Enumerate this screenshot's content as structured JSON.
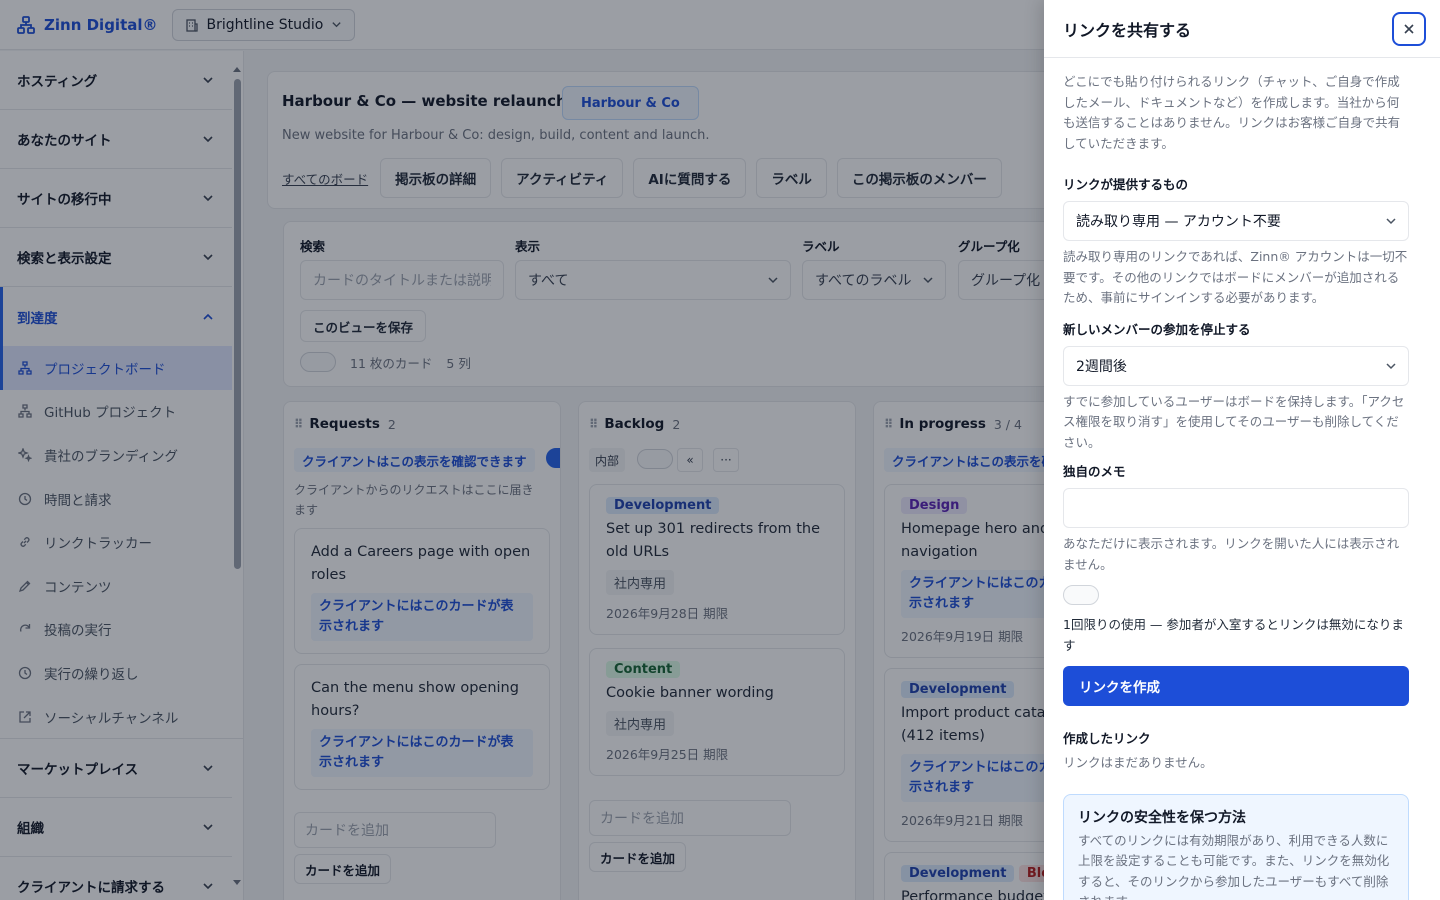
{
  "topbar": {
    "brand": "Zinn Digital®",
    "workspace": "Brightline Studio"
  },
  "sidebar": {
    "sections_top": [
      "ホスティング",
      "あなたのサイト",
      "サイトの移行中",
      "検索と表示設定"
    ],
    "active_section": "到達度",
    "items": [
      {
        "label": "プロジェクトボード",
        "icon": "board-icon",
        "active": true
      },
      {
        "label": "GitHub プロジェクト",
        "icon": "board-icon"
      },
      {
        "label": "貴社のブランディング",
        "icon": "sparkle-icon"
      },
      {
        "label": "時間と請求",
        "icon": "clock-icon"
      },
      {
        "label": "リンクトラッカー",
        "icon": "link-icon"
      },
      {
        "label": "コンテンツ",
        "icon": "pencil-icon"
      },
      {
        "label": "投稿の実行",
        "icon": "refresh-icon"
      },
      {
        "label": "実行の繰り返し",
        "icon": "clock-icon"
      },
      {
        "label": "ソーシャルチャンネル",
        "icon": "external-link-icon"
      }
    ],
    "sections_bottom": [
      "マーケットプレイス",
      "組織",
      "クライアントに請求する"
    ]
  },
  "project": {
    "title": "Harbour & Co — website relaunch",
    "client_badge": "Harbour & Co",
    "description": "New website for Harbour & Co: design, build, content and launch.",
    "all_boards_link": "すべてのボード",
    "tabs": [
      "掲示板の詳細",
      "アクティビティ",
      "AIに質問する",
      "ラベル",
      "この掲示板のメンバー"
    ]
  },
  "filters": {
    "search_label": "検索",
    "search_placeholder": "カードのタイトルまたは説明",
    "view_label": "表示",
    "view_value": "すべて",
    "label_label": "ラベル",
    "label_value": "すべてのラベル",
    "group_label": "グループ化",
    "group_value": "グループ化",
    "save_view": "このビューを保存",
    "card_count": "11 枚のカード",
    "column_count": "5 列"
  },
  "columns": [
    {
      "name": "Requests",
      "count": "2",
      "visibility": "クライアントはこの表示を確認できます",
      "description": "クライアントからのリクエストはここに届きます",
      "cards": [
        {
          "title": "Add a Careers page with open roles",
          "visible": "クライアントにはこのカードが表示されます"
        },
        {
          "title": "Can the menu show opening hours?",
          "visible": "クライアントにはこのカードが表示されます"
        }
      ],
      "add_placeholder": "カードを追加",
      "add_button": "カードを追加"
    },
    {
      "name": "Backlog",
      "count": "2",
      "internal": "内部",
      "collapse": "«",
      "more": "···",
      "cards": [
        {
          "tag": "Development",
          "title": "Set up 301 redirects from the old URLs",
          "internal": "社内専用",
          "due": "2026年9月28日 期限"
        },
        {
          "tag": "Content",
          "title": "Cookie banner wording",
          "internal": "社内専用",
          "due": "2026年9月25日 期限"
        }
      ],
      "add_placeholder": "カードを追加",
      "add_button": "カードを追加"
    },
    {
      "name": "In progress",
      "count": "3 / 4",
      "visibility": "クライアントはこの表示を確認できます",
      "cards": [
        {
          "tag": "Design",
          "title": "Homepage hero and navigation",
          "visible": "クライアントにはこのカードが表示されます",
          "due": "2026年9月19日 期限"
        },
        {
          "tag": "Development",
          "title": "Import product catalogue (412 items)",
          "visible": "クライアントにはこのカードが表示されます",
          "due": "2026年9月21日 期限"
        },
        {
          "tag": "Development",
          "tag2": "Blocked",
          "title": "Performance budget"
        }
      ]
    }
  ],
  "share_panel": {
    "title": "リンクを共有する",
    "intro": "どこにでも貼り付けられるリンク（チャット、ご自身で作成したメール、ドキュメントなど）を作成します。当社から何も送信することはありません。リンクはお客様ご自身で共有していただきます。",
    "provides_label": "リンクが提供するもの",
    "provides_value": "読み取り専用 — アカウント不要",
    "provides_help": "読み取り専用のリンクであれば、Zinn® アカウントは一切不要です。その他のリンクではボードにメンバーが追加されるため、事前にサインインする必要があります。",
    "stop_label": "新しいメンバーの参加を停止する",
    "stop_value": "2週間後",
    "stop_help": "すでに参加しているユーザーはボードを保持します。「アクセス権限を取り消す」を使用してそのユーザーも削除してください。",
    "memo_label": "独自のメモ",
    "memo_help": "あなただけに表示されます。リンクを開いた人には表示されません。",
    "single_use": "1回限りの使用 — 参加者が入室するとリンクは無効になります",
    "create_button": "リンクを作成",
    "created_label": "作成したリンク",
    "created_empty": "リンクはまだありません。",
    "tip_title": "リンクの安全性を保つ方法",
    "tip_body": "すべてのリンクには有効期限があり、利用できる人数に上限を設定することも可能です。また、リンクを無効化すると、そのリンクから参加したユーザーもすべて削除されます。"
  },
  "colors": {
    "accent": "#1d4ed8",
    "overlay": "rgba(17,24,39,0.42)"
  }
}
